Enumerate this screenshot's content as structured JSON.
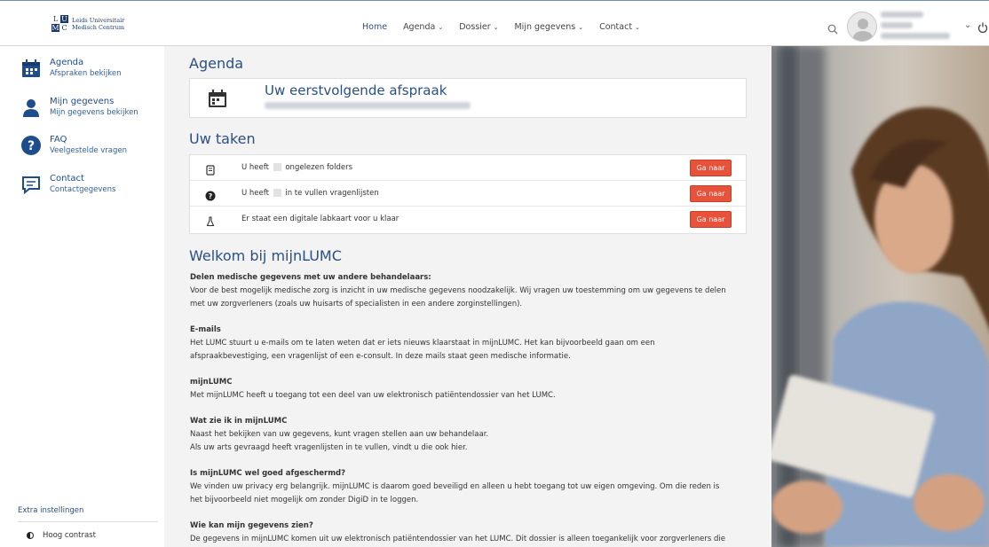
{
  "header": {
    "logo_letters": [
      "L",
      "U",
      "M",
      "C"
    ],
    "logo_line1": "Leids Universitair",
    "logo_line2": "Medisch Centrum",
    "nav": [
      {
        "label": "Home",
        "active": true
      },
      {
        "label": "Agenda",
        "dropdown": true
      },
      {
        "label": "Dossier",
        "dropdown": true
      },
      {
        "label": "Mijn gegevens",
        "dropdown": true
      },
      {
        "label": "Contact",
        "dropdown": true
      }
    ],
    "icons": {
      "search": "search-icon",
      "avatar": "user-avatar",
      "caret": "chevron-down-icon",
      "power": "power-icon"
    }
  },
  "sidebar": {
    "items": [
      {
        "title": "Agenda",
        "subtitle": "Afspraken bekijken",
        "icon": "calendar-icon"
      },
      {
        "title": "Mijn gegevens",
        "subtitle": "Mijn gegevens bekijken",
        "icon": "person-icon"
      },
      {
        "title": "FAQ",
        "subtitle": "Veelgestelde vragen",
        "icon": "question-icon"
      },
      {
        "title": "Contact",
        "subtitle": "Contactgegevens",
        "icon": "chat-icon"
      }
    ],
    "extra_settings": "Extra instellingen",
    "high_contrast": "Hoog contrast"
  },
  "main": {
    "agenda_heading": "Agenda",
    "next_appointment_title": "Uw eerstvolgende afspraak",
    "tasks_heading": "Uw taken",
    "tasks": [
      {
        "prefix": "U heeft",
        "suffix": "ongelezen folders",
        "button": "Ga naar",
        "icon": "folder-icon"
      },
      {
        "prefix": "U heeft",
        "suffix": "in te vullen vragenlijsten",
        "button": "Ga naar",
        "icon": "question-icon"
      },
      {
        "prefix": "Er staat een digitale labkaart voor u klaar",
        "suffix": "",
        "button": "Ga naar",
        "icon": "lab-flask-icon"
      }
    ],
    "welcome_heading": "Welkom bij mijnLUMC",
    "sections": [
      {
        "title": "Delen medische gegevens met uw andere behandelaars:",
        "lines": [
          "Voor de best mogelijk medische zorg is inzicht in uw medische gegevens noodzakelijk. Wij vragen uw toestemming om uw gegevens te delen",
          "met uw zorgverleners (zoals uw huisarts of specialisten in een andere zorginstellingen)."
        ]
      },
      {
        "title": "E-mails",
        "lines": [
          "Het LUMC stuurt u e-mails om te laten weten dat er iets nieuws klaarstaat in mijnLUMC. Het kan bijvoorbeeld gaan om een",
          "afspraakbevestiging, een vragenlijst of een e-consult. In deze mails staat geen medische informatie."
        ]
      },
      {
        "title": "mijnLUMC",
        "lines": [
          "Met mijnLUMC heeft u toegang tot een deel van uw elektronisch patiëntendossier van het LUMC."
        ]
      },
      {
        "title": "Wat zie ik in mijnLUMC",
        "lines": [
          "Naast het bekijken van uw gegevens, kunt vragen stellen aan uw behandelaar.",
          "Als uw arts gevraagd heeft vragenlijsten in te vullen, vindt u die ook hier."
        ]
      },
      {
        "title": "Is mijnLUMC wel goed afgeschermd?",
        "lines": [
          "We vinden uw privacy erg belangrijk. mijnLUMC is daarom goed beveiligd en alleen u hebt toegang tot uw eigen omgeving. Om die reden is",
          "het bijvoorbeeld niet mogelijk om zonder DigiD in te loggen."
        ]
      },
      {
        "title": "Wie kan mijn gegevens zien?",
        "lines": [
          "De gegevens in mijnLUMC komen uit uw elektronisch patiëntendossier van het LUMC. Dit dossier is alleen toegankelijk voor zorgverleners die"
        ]
      }
    ]
  },
  "colors": {
    "accent": "#2a4f87",
    "button": "#e8513a",
    "background": "#f3f3f3"
  }
}
